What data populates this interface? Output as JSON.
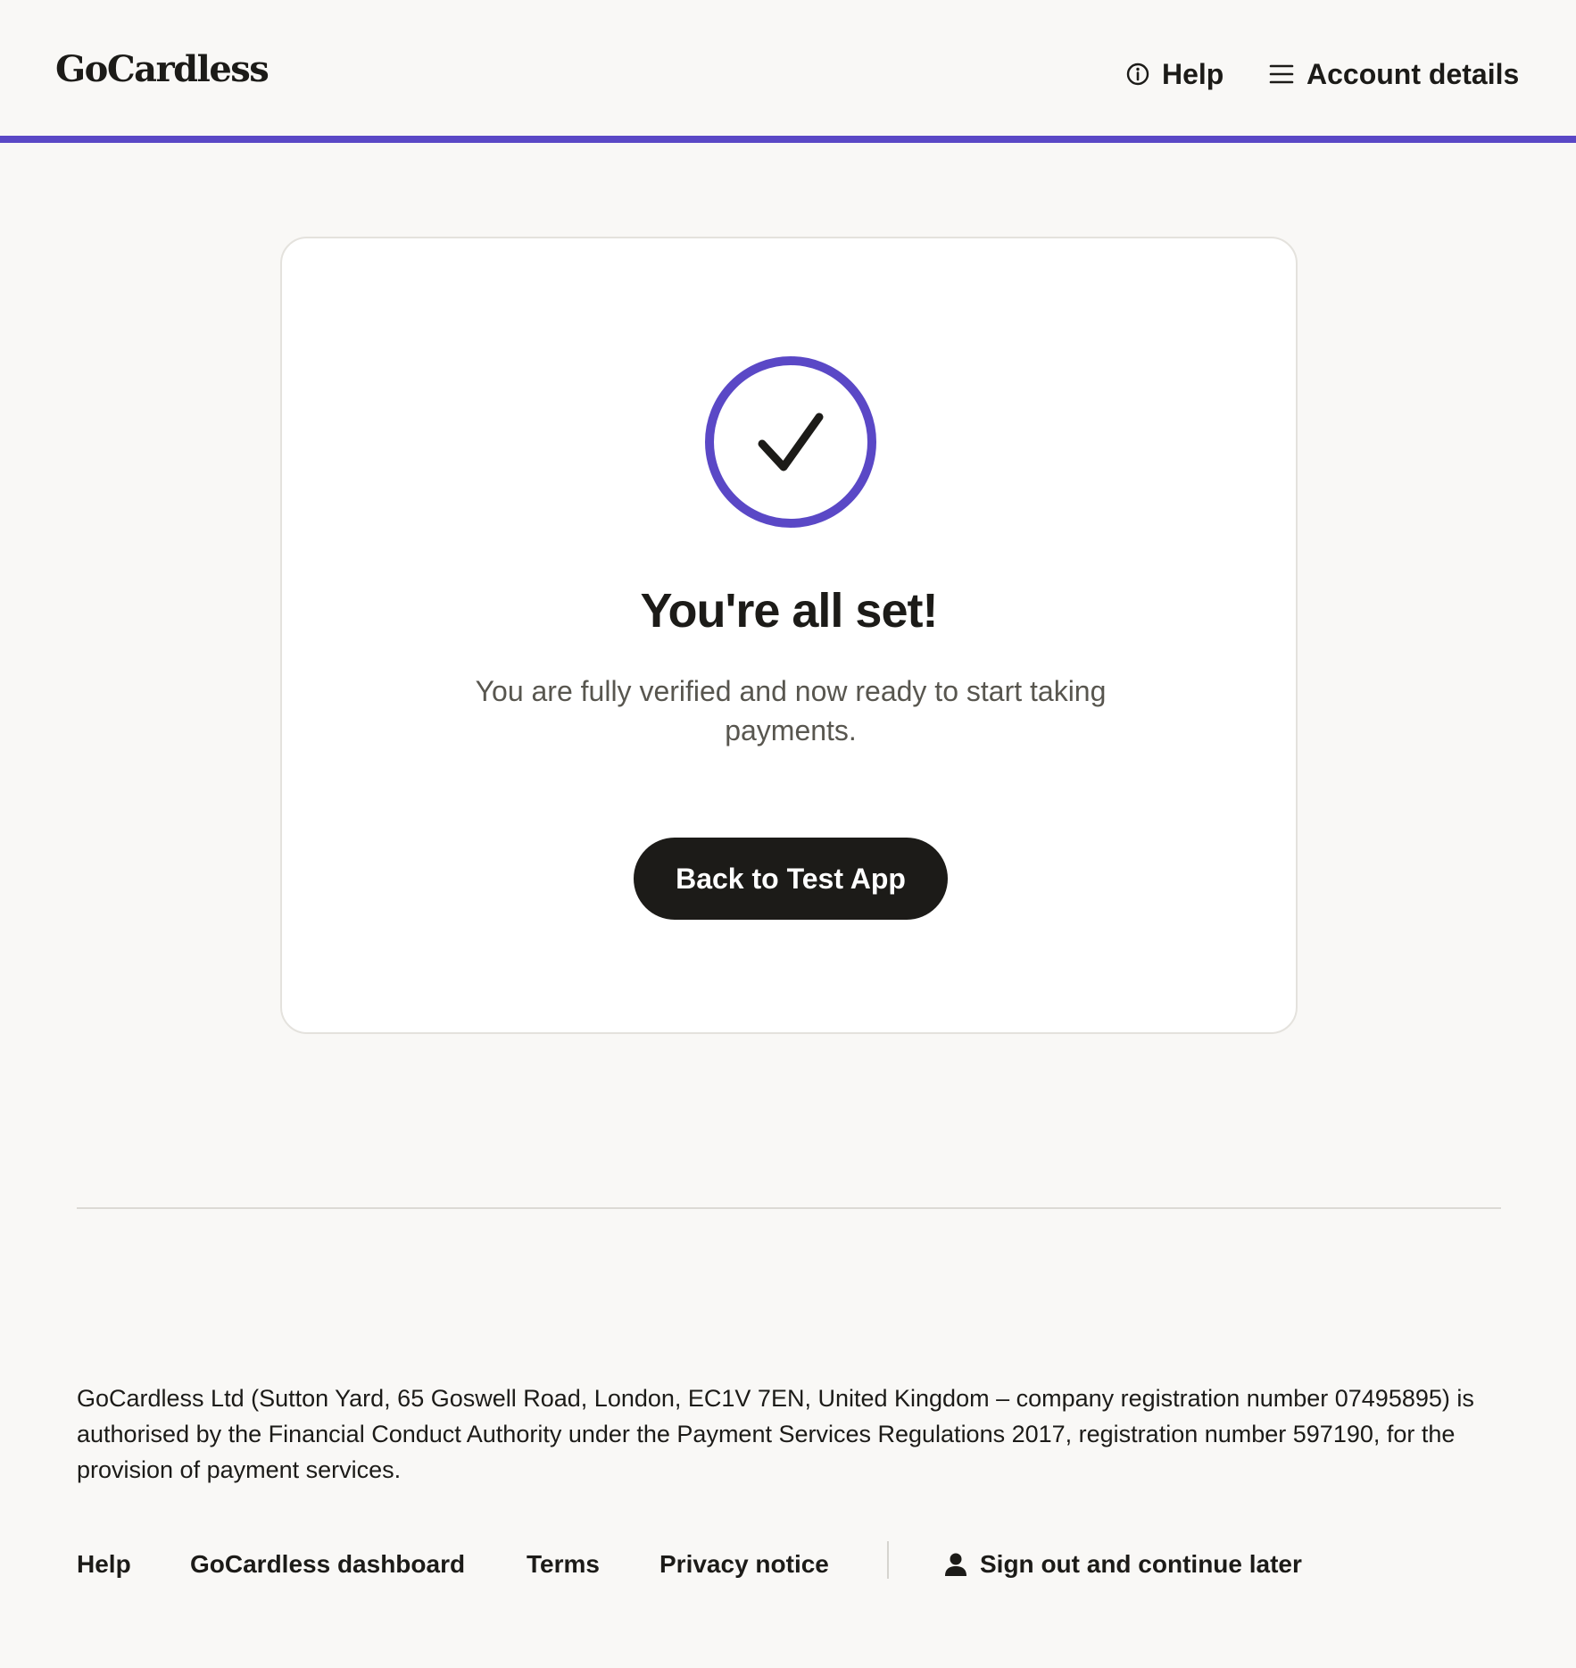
{
  "header": {
    "logo": "GoCardless",
    "help_label": "Help",
    "account_label": "Account details",
    "accent_color": "#5a48c6"
  },
  "card": {
    "title": "You're all set!",
    "subtitle": "You are fully verified and now ready to start taking payments.",
    "button_label": "Back to Test App",
    "icon": "check-circle-icon"
  },
  "footer": {
    "legal": "GoCardless Ltd (Sutton Yard, 65 Goswell Road, London, EC1V 7EN, United Kingdom – company registration number 07495895) is authorised by the Financial Conduct Authority under the Payment Services Regulations 2017, registration number 597190, for the provision of payment services.",
    "links": {
      "help": "Help",
      "dashboard": "GoCardless dashboard",
      "terms": "Terms",
      "privacy": "Privacy notice",
      "signout": "Sign out and continue later"
    }
  }
}
